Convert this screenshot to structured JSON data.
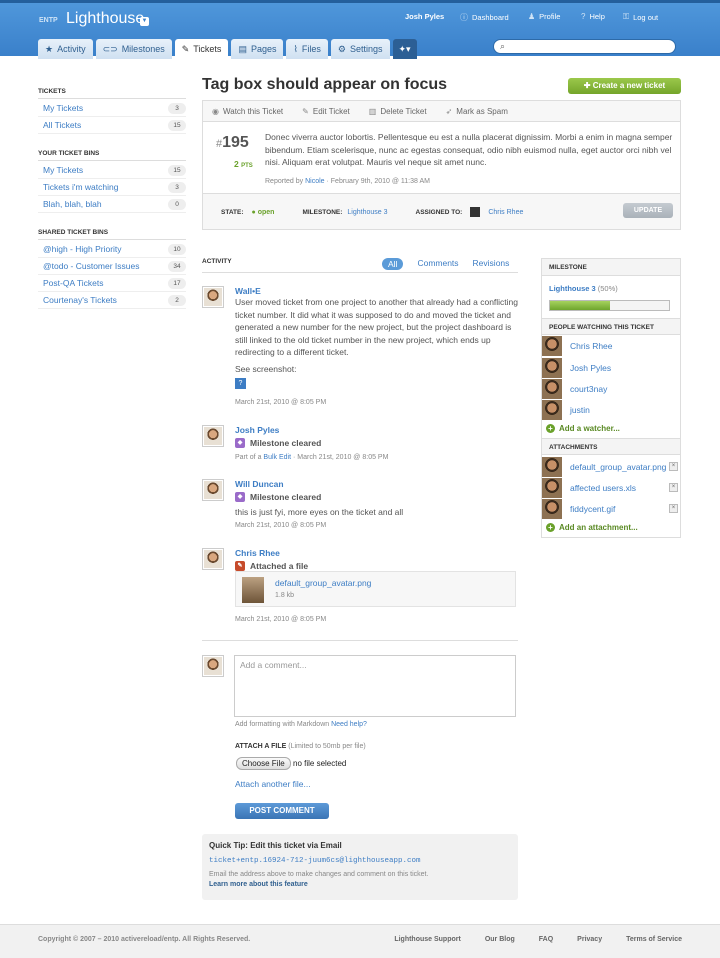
{
  "header": {
    "org": "ENTP",
    "project": "Lighthouse",
    "user": "Josh Pyles",
    "links": [
      "Dashboard",
      "Profile",
      "Help",
      "Log out"
    ]
  },
  "tabs": [
    "Activity",
    "Milestones",
    "Tickets",
    "Pages",
    "Files",
    "Settings"
  ],
  "sidebar": {
    "tickets_h": "TICKETS",
    "tickets": [
      {
        "label": "My Tickets",
        "count": "3"
      },
      {
        "label": "All Tickets",
        "count": "15"
      }
    ],
    "bins_h": "YOUR TICKET BINS",
    "bins": [
      {
        "label": "My Tickets",
        "count": "15"
      },
      {
        "label": "Tickets i'm watching",
        "count": "3"
      },
      {
        "label": "Blah, blah, blah",
        "count": "0"
      }
    ],
    "shared_h": "SHARED TICKET BINS",
    "shared": [
      {
        "label": "@high - High Priority",
        "count": "10"
      },
      {
        "label": "@todo - Customer Issues",
        "count": "34"
      },
      {
        "label": "Post-QA Tickets",
        "count": "17"
      },
      {
        "label": "Courtenay's Tickets",
        "count": "2"
      }
    ]
  },
  "ticket": {
    "title": "Tag box should appear on focus",
    "create": "Create a new ticket",
    "actions": [
      "Watch this Ticket",
      "Edit Ticket",
      "Delete Ticket",
      "Mark as Spam"
    ],
    "hash": "#",
    "number": "195",
    "points": "2",
    "pts_label": "PTS",
    "description": "Donec viverra auctor lobortis. Pellentesque eu est a nulla placerat dignissim. Morbi a enim in magna semper bibendum. Etiam scelerisque, nunc ac egestas consequat, odio nibh euismod nulla, eget auctor orci nibh vel nisi. Aliquam erat volutpat. Mauris vel neque sit amet nunc.",
    "reported_pre": "Reported by",
    "reporter": "Nicole",
    "reported_post": "· February 9th, 2010 @ 11:38 AM",
    "state_l": "STATE:",
    "state": "open",
    "milestone_l": "MILESTONE:",
    "milestone": "Lighthouse 3",
    "assigned_l": "ASSIGNED TO:",
    "assigned": "Chris Rhee",
    "update": "UPDATE"
  },
  "activity": {
    "heading": "ACTIVITY",
    "filters": [
      "All",
      "Comments",
      "Revisions"
    ],
    "e1": {
      "who": "Wall•E",
      "text": "User moved ticket from one project to another that already had a conflicting ticket number. It did what it was supposed to do and moved the ticket and generated a new number for the new project, but the project dashboard is still linked to the old ticket number in the new project, which ends up redirecting to a different ticket.",
      "see": "See screenshot:",
      "date": "March 21st, 2010 @ 8:05 PM"
    },
    "e2": {
      "who": "Josh Pyles",
      "event": "Milestone cleared",
      "meta_pre": "Part of a",
      "link": "Bulk Edit",
      "meta_post": "· March 21st, 2010 @ 8:05 PM"
    },
    "e3": {
      "who": "Will Duncan",
      "event": "Milestone cleared",
      "text": "this is just fyi, more eyes on the ticket and all",
      "date": "March 21st, 2010 @ 8:05 PM"
    },
    "e4": {
      "who": "Chris Rhee",
      "event": "Attached a file",
      "file": "default_group_avatar.png",
      "size": "1.8 kb",
      "date": "March 21st, 2010 @ 8:05 PM"
    }
  },
  "comment": {
    "placeholder": "Add a comment...",
    "fmt": "Add formatting with Markdown",
    "help": "Need help?",
    "attach_l": "ATTACH A FILE",
    "attach_limit": "(Limited to 50mb per file)",
    "choose": "Choose File",
    "nofile": "no file selected",
    "another": "Attach another file...",
    "post": "POST COMMENT"
  },
  "tip": {
    "title": "Quick Tip: Edit this ticket via Email",
    "email": "ticket+entp.16924-712-juum6cs@lighthouseapp.com",
    "text": "Email the address above to make changes and comment on this ticket.",
    "link": "Learn more about this feature"
  },
  "right": {
    "milestone_h": "MILESTONE",
    "milestone": "Lighthouse 3",
    "percent": "(50%)",
    "progress": 0.5,
    "watch_h": "PEOPLE WATCHING THIS TICKET",
    "watchers": [
      "Chris Rhee",
      "Josh Pyles",
      "court3nay",
      "justin"
    ],
    "add_watcher": "Add a watcher...",
    "attach_h": "ATTACHMENTS",
    "attachments": [
      "default_group_avatar.png",
      "affected users.xls",
      "fiddycent.gif"
    ],
    "add_attach": "Add an attachment..."
  },
  "footer": {
    "copy": "Copyright © 2007 – 2010 activereload/entp. All Rights Reserved.",
    "links": [
      "Lighthouse Support",
      "Our Blog",
      "FAQ",
      "Privacy",
      "Terms of Service"
    ]
  }
}
